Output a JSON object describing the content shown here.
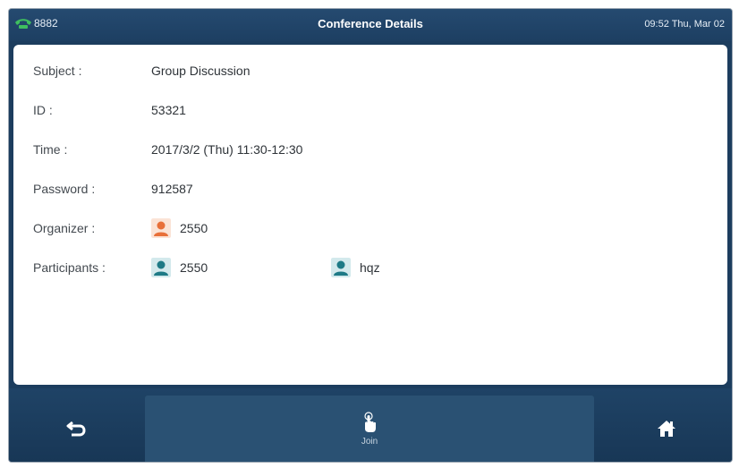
{
  "status_bar": {
    "line_icon": "phone-handset-icon",
    "line_number": "8882",
    "title": "Conference Details",
    "clock": "09:52 Thu, Mar 02"
  },
  "details": {
    "subject": {
      "label": "Subject :",
      "value": "Group Discussion"
    },
    "id": {
      "label": "ID :",
      "value": "53321"
    },
    "time": {
      "label": "Time :",
      "value": "2017/3/2 (Thu) 11:30-12:30"
    },
    "password": {
      "label": "Password :",
      "value": "912587"
    },
    "organizer": {
      "label": "Organizer :",
      "name": "2550",
      "icon": "organizer-contact-icon",
      "icon_color": "#e8703a"
    },
    "participants": {
      "label": "Participants :",
      "icon_color": "#1e7a86",
      "items": [
        {
          "name": "2550",
          "icon": "participant-contact-icon"
        },
        {
          "name": "hqz",
          "icon": "participant-contact-icon"
        }
      ]
    }
  },
  "softkeys": {
    "back": {
      "icon": "back-arrow-icon"
    },
    "join": {
      "label": "Join",
      "icon": "tap-hand-icon"
    },
    "home": {
      "icon": "home-icon"
    }
  },
  "colors": {
    "frame": "#1c3d5e",
    "status_bar": "#254a70",
    "softkey_active": "#2a5173",
    "organizer_accent": "#e8703a",
    "participant_accent": "#1e7a86"
  }
}
